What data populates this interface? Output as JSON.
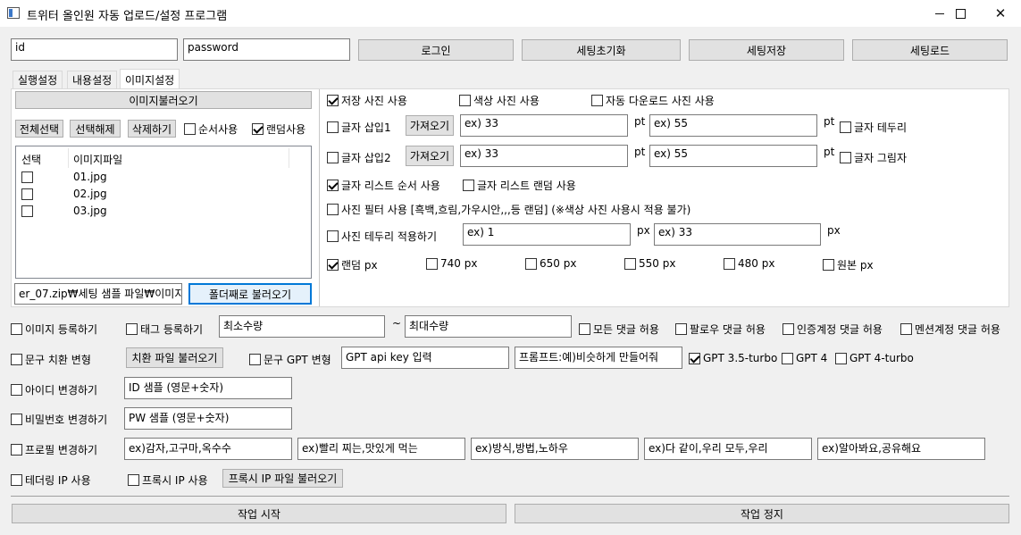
{
  "window": {
    "title": "트위터 올인원 자동 업로드/설정 프로그램",
    "close_glyph": "✕"
  },
  "login": {
    "id_value": "id",
    "password_value": "password",
    "login_label": "로그인",
    "reset_label": "세팅초기화",
    "save_label": "세팅저장",
    "load_label": "세팅로드"
  },
  "tabs": [
    {
      "label": "실행설정"
    },
    {
      "label": "내용설정"
    },
    {
      "label": "이미지설정"
    }
  ],
  "image_tab": {
    "load_images_label": "이미지불러오기",
    "select_all_label": "전체선택",
    "deselect_label": "선택해제",
    "delete_label": "삭제하기",
    "order_use_label": "순서사용",
    "random_use_label": "랜덤사용",
    "columns": [
      "선택",
      "이미지파일"
    ],
    "files": [
      {
        "name": "01.jpg"
      },
      {
        "name": "02.jpg"
      },
      {
        "name": "03.jpg"
      }
    ],
    "folder_path": "er_07.zip₩세팅 샘플 파일₩이미지",
    "folder_load_label": "폴더째로 불러오기"
  },
  "image_options": {
    "saved_photo_label": "저장 사진 사용",
    "color_photo_label": "색상 사진 사용",
    "auto_download_label": "자동 다운로드 사진 사용",
    "text_insert1_label": "글자 삽입1",
    "text_insert2_label": "글자 삽입2",
    "import_label": "가져오기",
    "insert1_val1": "ex) 33",
    "insert1_val2": "ex) 55",
    "insert2_val1": "ex) 33",
    "insert2_val2": "ex) 55",
    "unit_pt": "pt",
    "unit_px": "px",
    "text_border_label": "글자 테두리",
    "text_shadow_label": "글자 그림자",
    "text_list_order_label": "글자 리스트 순서 사용",
    "text_list_random_label": "글자 리스트 랜덤 사용",
    "photo_filter_label": "사진 필터 사용 [흑백,흐림,가우시안,,,등 랜덤] (※색상 사진 사용시 적용 불가)",
    "photo_border_label": "사진 테두리 적용하기",
    "border_val1": "ex) 1",
    "border_val2": "ex) 33",
    "size_random_label": "랜덤 px",
    "size_740": "740 px",
    "size_650": "650 px",
    "size_550": "550 px",
    "size_480": "480 px",
    "size_original": "원본 px"
  },
  "bottom": {
    "image_register_label": "이미지 등록하기",
    "tag_register_label": "태그 등록하기",
    "min_count": "최소수량",
    "tilde": "~",
    "max_count": "최대수량",
    "allow_all_comments": "모든 댓글 허용",
    "follower_comments": "팔로우 댓글 허용",
    "verified_comments": "인증계정 댓글 허용",
    "mention_comments": "멘션계정 댓글 허용",
    "phrase_replace_label": "문구 치환 변형",
    "replace_file_load_label": "치환 파일 불러오기",
    "phrase_gpt_label": "문구 GPT 변형",
    "gpt_key_value": "GPT api key 입력",
    "prompt_value": "프롬프트:예)비슷하게 만들어줘",
    "gpt35_label": "GPT 3.5-turbo",
    "gpt4_label": "GPT 4",
    "gpt4turbo_label": "GPT 4-turbo",
    "id_change_label": "아이디 변경하기",
    "id_sample_value": "ID 샘플 (영문+숫자)",
    "pw_change_label": "비밀번호 변경하기",
    "pw_sample_value": "PW 샘플 (영문+숫자)",
    "profile_change_label": "프로필 변경하기",
    "profile_values": [
      "ex)감자,고구마,옥수수",
      "ex)빨리 찌는,맛있게 먹는",
      "ex)방식,방법,노하우",
      "ex)다 같이,우리 모두,우리",
      "ex)알아봐요,공유해요"
    ],
    "tethering_label": "테더링 IP 사용",
    "proxy_label": "프록시 IP 사용",
    "proxy_file_label": "프록시 IP 파일 불러오기",
    "start_label": "작업 시작",
    "stop_label": "작업 정지"
  }
}
